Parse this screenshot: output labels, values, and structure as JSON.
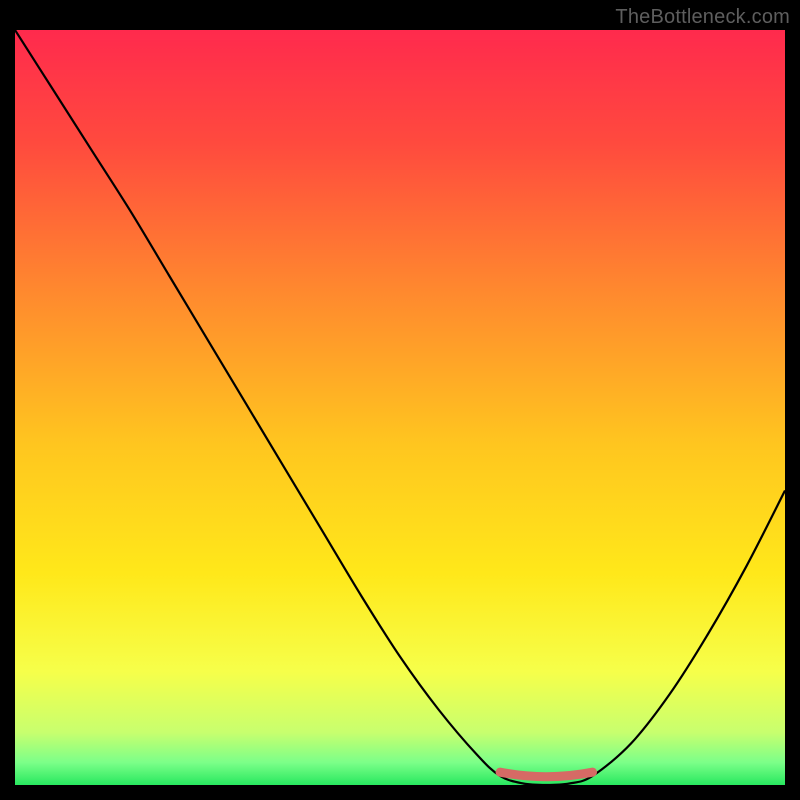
{
  "watermark": "TheBottleneck.com",
  "chart_data": {
    "type": "line",
    "title": "",
    "xlabel": "",
    "ylabel": "",
    "xlim": [
      0,
      100
    ],
    "ylim": [
      0,
      100
    ],
    "curve_x": [
      0,
      5,
      10,
      15,
      20,
      25,
      30,
      35,
      40,
      45,
      50,
      55,
      60,
      63,
      66,
      69,
      72,
      75,
      80,
      85,
      90,
      95,
      100
    ],
    "curve_y": [
      100,
      92.0,
      84.0,
      76.0,
      67.5,
      59.0,
      50.5,
      42.0,
      33.5,
      25.0,
      17.0,
      10.0,
      4.0,
      1.2,
      0.2,
      0.0,
      0.2,
      1.2,
      5.5,
      12.0,
      20.0,
      29.0,
      39.0
    ],
    "optimal_zone": {
      "x_start": 63,
      "x_end": 75,
      "y": 0.5
    },
    "gradient_stops": [
      {
        "offset": 0.0,
        "color": "#ff2a4d"
      },
      {
        "offset": 0.15,
        "color": "#ff4a3e"
      },
      {
        "offset": 0.35,
        "color": "#ff8a2e"
      },
      {
        "offset": 0.55,
        "color": "#ffc61f"
      },
      {
        "offset": 0.72,
        "color": "#ffe81a"
      },
      {
        "offset": 0.85,
        "color": "#f6ff4a"
      },
      {
        "offset": 0.93,
        "color": "#c8ff6e"
      },
      {
        "offset": 0.97,
        "color": "#7cff89"
      },
      {
        "offset": 1.0,
        "color": "#28e85f"
      }
    ],
    "curve_stroke": "#000000",
    "marker_color": "#d66a65"
  }
}
